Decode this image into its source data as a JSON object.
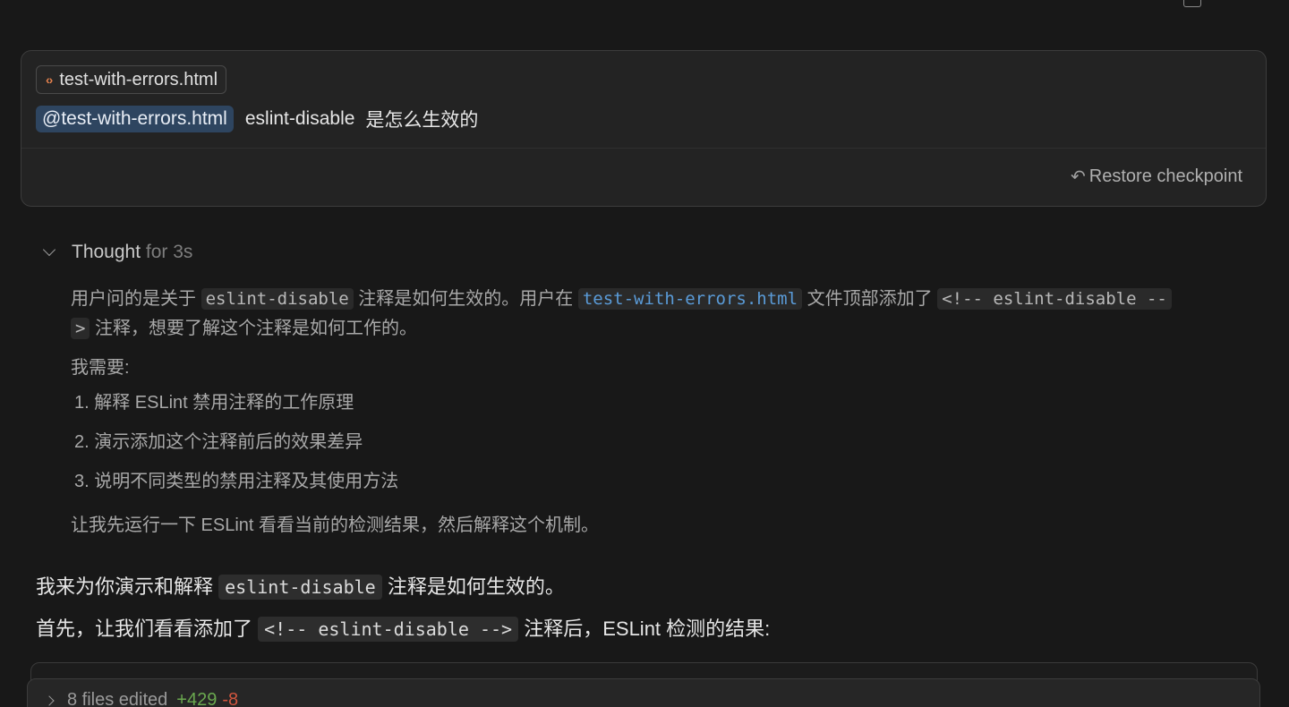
{
  "user_message": {
    "file_chip": "test-with-errors.html",
    "mention": "@test-with-errors.html",
    "prompt_text": "eslint-disable",
    "prompt_text_2": "是怎么生效的",
    "restore_label": "Restore checkpoint"
  },
  "thought": {
    "title": "Thought",
    "duration": "for 3s",
    "p1_a": "用户问的是关于",
    "p1_code1": "eslint-disable",
    "p1_b": "注释是如何生效的。用户在",
    "p1_code2": "test-with-errors.html",
    "p1_c": "文件顶部添加了",
    "p1_code3": "<!-- eslint-disable --",
    "p1_code3b": ">",
    "p1_d": "注释，想要了解这个注释是如何工作的。",
    "p2": "我需要:",
    "list": [
      "1. 解释 ESLint 禁用注释的工作原理",
      "2. 演示添加这个注释前后的效果差异",
      "3. 说明不同类型的禁用注释及其使用方法"
    ],
    "p3": "让我先运行一下 ESLint 看看当前的检测结果，然后解释这个机制。"
  },
  "answer": {
    "l1_a": "我来为你演示和解释",
    "l1_code": "eslint-disable",
    "l1_b": "注释是如何生效的。",
    "l2_a": "首先，让我们看看添加了",
    "l2_code": "<!-- eslint-disable -->",
    "l2_b": "注释后，ESLint 检测的结果:"
  },
  "files_bar": {
    "label": "8 files edited",
    "added": "+429",
    "removed": "-8"
  },
  "colors": {
    "background": "#181818",
    "mention_bg": "#2e4560",
    "link": "#5a9bd8",
    "added": "#6aa84f",
    "removed": "#d0553e"
  }
}
